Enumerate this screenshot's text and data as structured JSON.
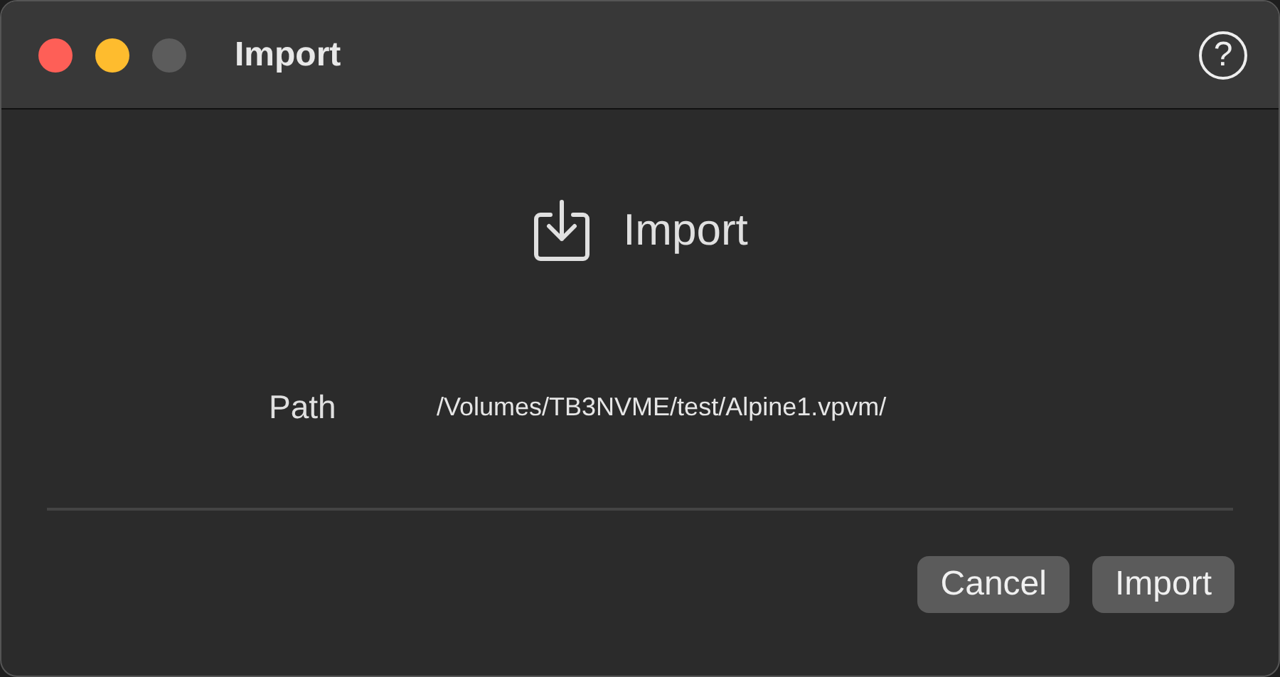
{
  "window": {
    "title": "Import",
    "controls": [
      {
        "color": "#fe5f57"
      },
      {
        "color": "#febc2e"
      },
      {
        "color": "#5c5c5c"
      }
    ],
    "help": "?"
  },
  "header": {
    "title": "Import"
  },
  "fields": [
    {
      "label": "Path",
      "value": "/Volumes/TB3NVME/test/Alpine1.vpvm/"
    }
  ],
  "buttons": [
    "Cancel",
    "Import"
  ]
}
